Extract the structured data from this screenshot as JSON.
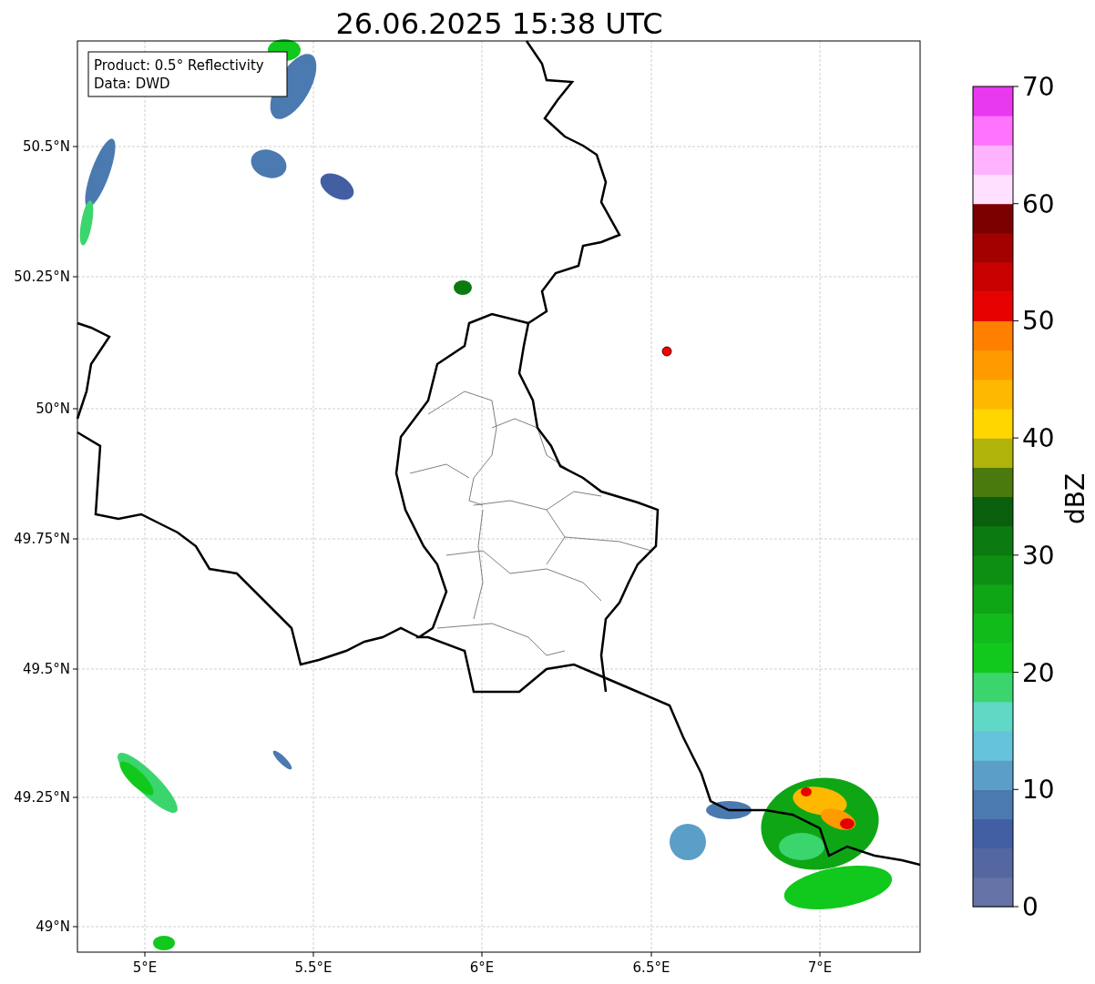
{
  "title": "26.06.2025 15:38 UTC",
  "legend": [
    "Product: 0.5° Reflectivity",
    "Data: DWD"
  ],
  "x_ticks": [
    "5°E",
    "5.5°E",
    "6°E",
    "6.5°E",
    "7°E"
  ],
  "y_ticks": [
    "50.5°N",
    "50.25°N",
    "50°N",
    "49.75°N",
    "49.5°N",
    "49.25°N",
    "49°N"
  ],
  "colorbar": {
    "label": "dBZ",
    "ticks": [
      "70",
      "60",
      "50",
      "40",
      "30",
      "20",
      "10",
      "0"
    ],
    "segments": [
      {
        "color": "#6673a6"
      },
      {
        "color": "#5567a0"
      },
      {
        "color": "#435fa3"
      },
      {
        "color": "#4b7ab0"
      },
      {
        "color": "#5b9ec7"
      },
      {
        "color": "#65c3dc"
      },
      {
        "color": "#5fd8c6"
      },
      {
        "color": "#3bd56e"
      },
      {
        "color": "#11c91c"
      },
      {
        "color": "#10bb1a"
      },
      {
        "color": "#0fa615"
      },
      {
        "color": "#0c8f12"
      },
      {
        "color": "#0b7a10"
      },
      {
        "color": "#095f0b"
      },
      {
        "color": "#4a7a0e"
      },
      {
        "color": "#b0b30a"
      },
      {
        "color": "#ffd600"
      },
      {
        "color": "#ffb800"
      },
      {
        "color": "#ff9a00"
      },
      {
        "color": "#ff7f00"
      },
      {
        "color": "#e60000"
      },
      {
        "color": "#c80000"
      },
      {
        "color": "#a30000"
      },
      {
        "color": "#7d0000"
      },
      {
        "color": "#ffe0ff"
      },
      {
        "color": "#ffb3ff"
      },
      {
        "color": "#ff73ff"
      },
      {
        "color": "#e838f0"
      }
    ]
  }
}
